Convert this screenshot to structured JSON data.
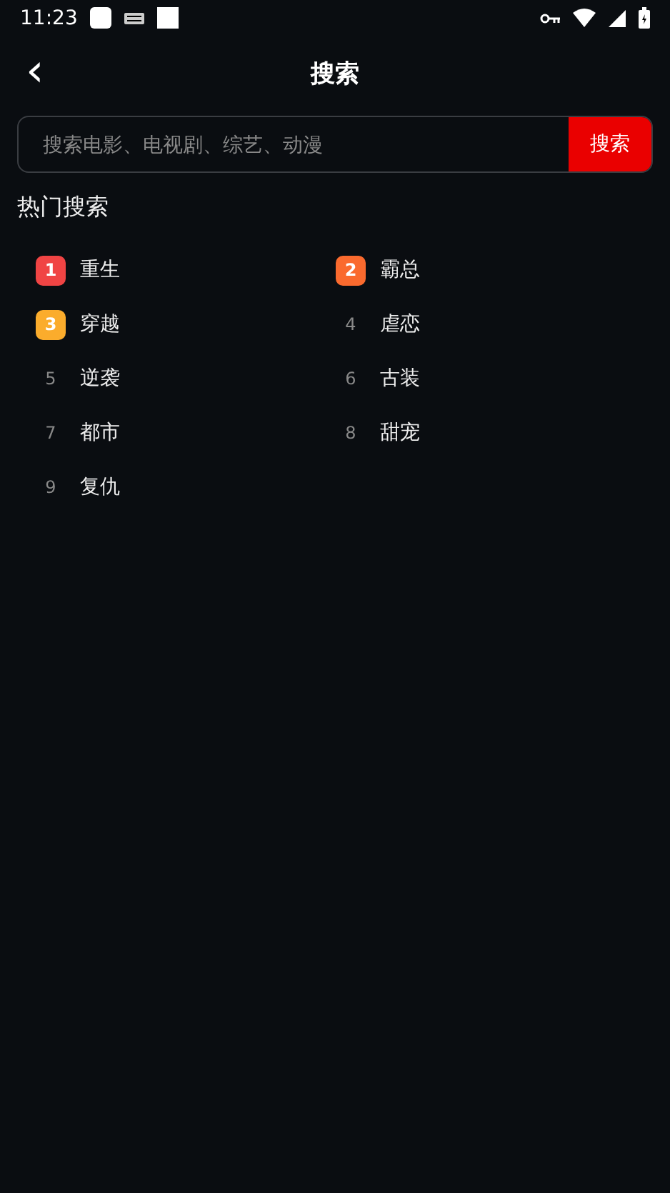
{
  "status_bar": {
    "time": "11:23"
  },
  "header": {
    "back": "‹",
    "title": "搜索"
  },
  "search": {
    "placeholder": "搜索电影、电视剧、综艺、动漫",
    "button": "搜索"
  },
  "hot": {
    "title": "热门搜索",
    "items": [
      {
        "rank": "1",
        "label": "重生",
        "color": "#f04444"
      },
      {
        "rank": "2",
        "label": "霸总",
        "color": "#fa6a2e"
      },
      {
        "rank": "3",
        "label": "穿越",
        "color": "#fbac2c"
      },
      {
        "rank": "4",
        "label": "虐恋"
      },
      {
        "rank": "5",
        "label": "逆袭"
      },
      {
        "rank": "6",
        "label": "古装"
      },
      {
        "rank": "7",
        "label": "都市"
      },
      {
        "rank": "8",
        "label": "甜宠"
      },
      {
        "rank": "9",
        "label": "复仇"
      }
    ]
  }
}
